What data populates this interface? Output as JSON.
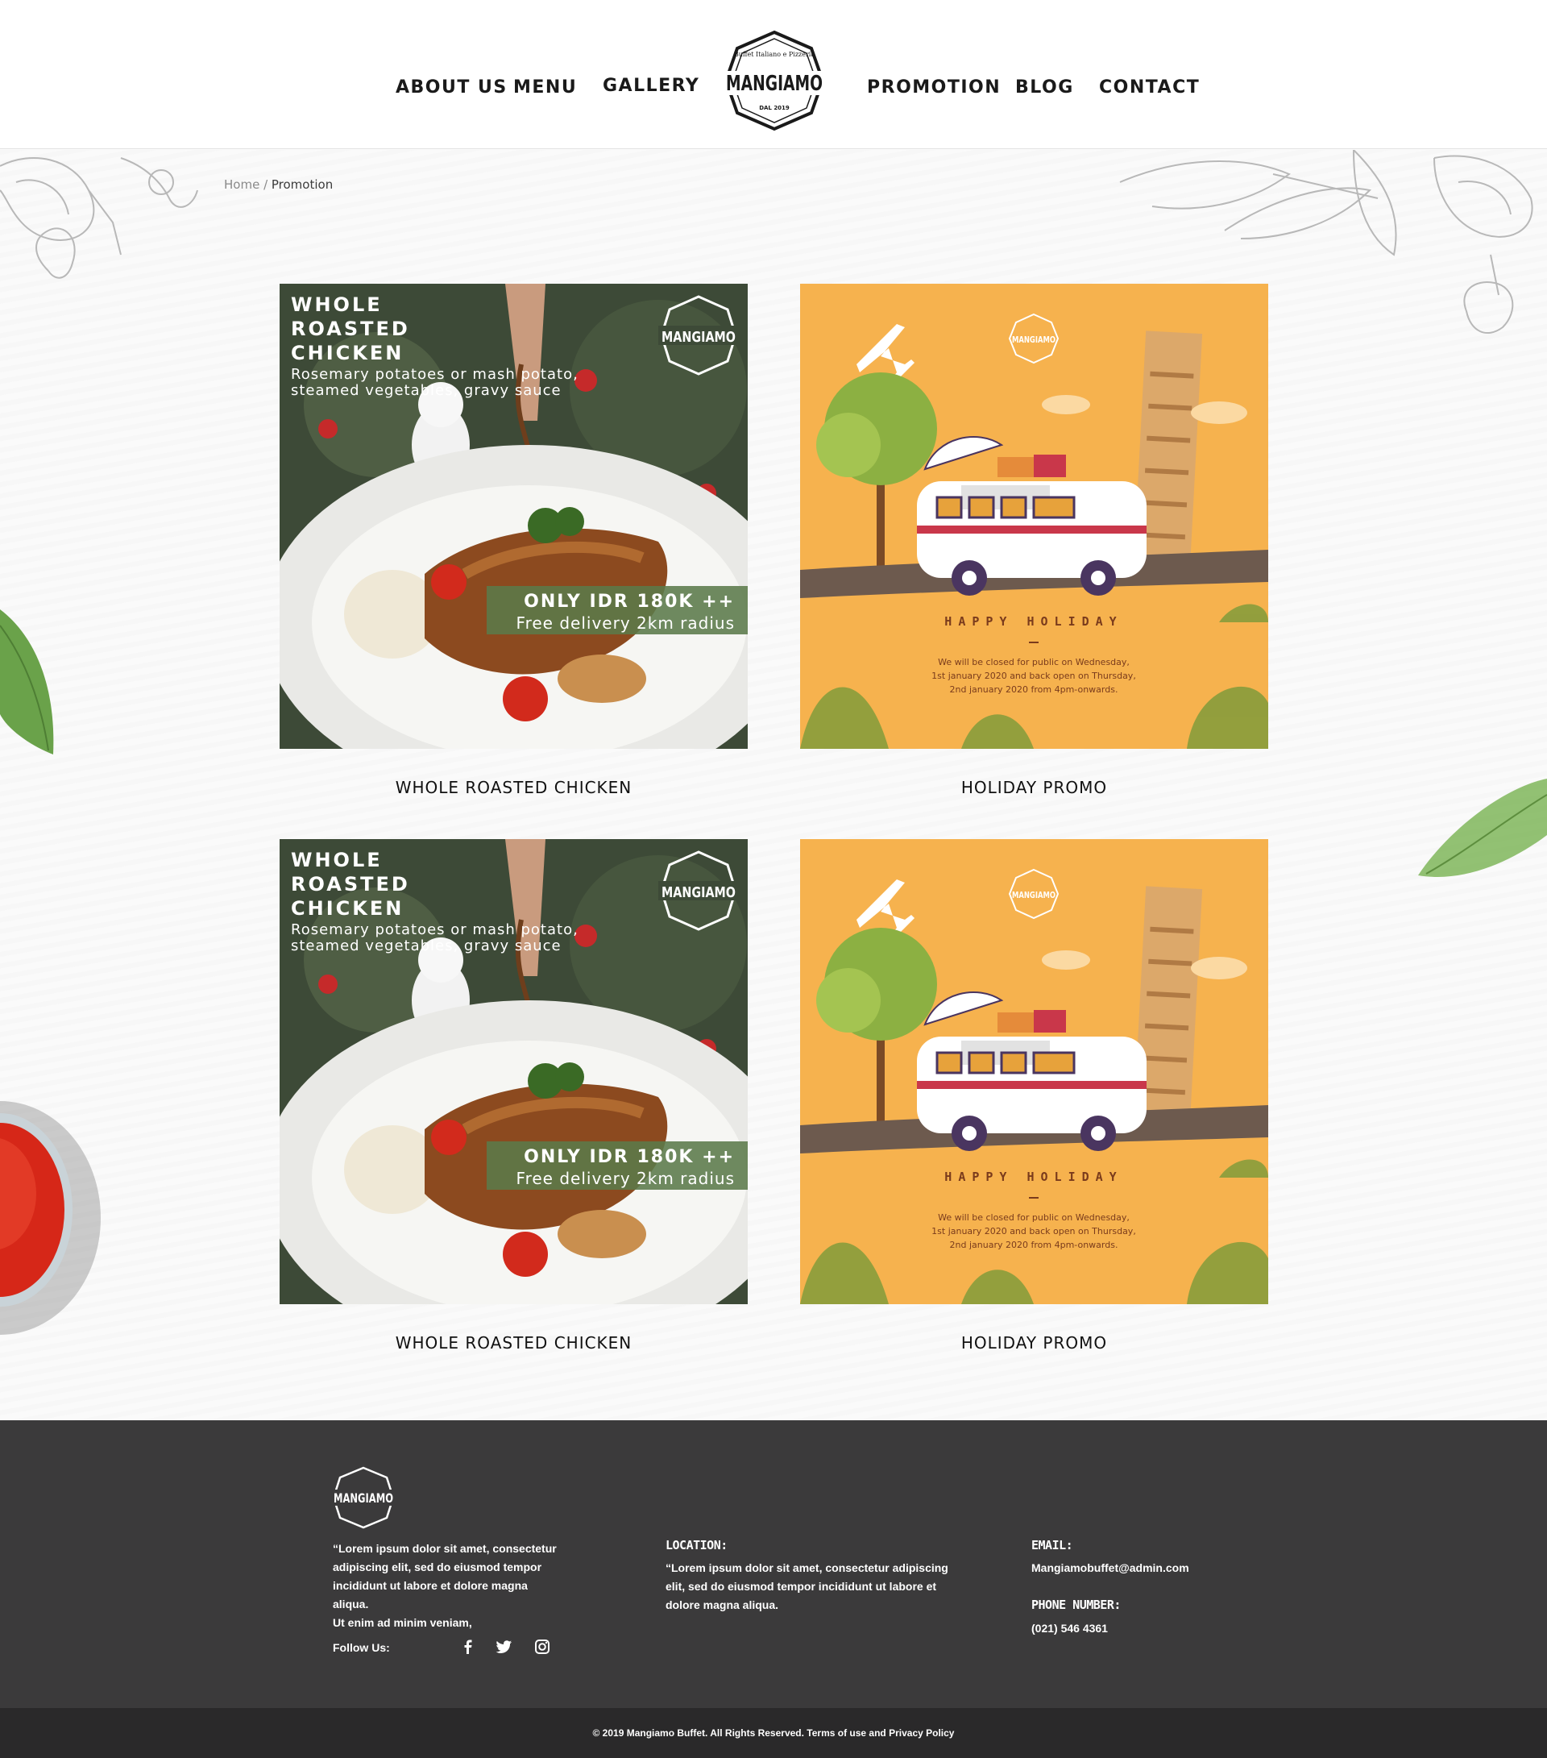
{
  "nav": {
    "about": "ABOUT US",
    "menu": "MENU",
    "gallery": "GALLERY",
    "promotion": "PROMOTION",
    "blog": "BLOG",
    "contact": "CONTACT"
  },
  "logo": {
    "name": "MANGIAMO",
    "tagline": "Buffet Italiano e Pizzeria",
    "year": "DAL 2019"
  },
  "breadcrumb": {
    "home": "Home",
    "separator": " / ",
    "current": "Promotion"
  },
  "promos": [
    {
      "title": "WHOLE ROASTED CHICKEN",
      "image": {
        "line1": "WHOLE",
        "line2": "ROASTED",
        "line3": "CHICKEN",
        "sub1": "Rosemary potatoes or mash potato,",
        "sub2": "steamed vegetables, gravy sauce",
        "price": "ONLY IDR 180K ++",
        "delivery": "Free delivery 2km radius"
      }
    },
    {
      "title": "HOLIDAY PROMO",
      "image": {
        "headline": "HAPPY HOLIDAY",
        "body1": "We will be closed for public on Wednesday,",
        "body2": "1st january 2020 and back open on Thursday,",
        "body3": "2nd january 2020 from 4pm-onwards."
      }
    },
    {
      "title": "WHOLE ROASTED CHICKEN",
      "image": {
        "line1": "WHOLE",
        "line2": "ROASTED",
        "line3": "CHICKEN",
        "sub1": "Rosemary potatoes or mash potato,",
        "sub2": "steamed vegetables, gravy sauce",
        "price": "ONLY IDR 180K ++",
        "delivery": "Free delivery 2km radius"
      }
    },
    {
      "title": "HOLIDAY PROMO",
      "image": {
        "headline": "HAPPY HOLIDAY",
        "body1": "We will be closed for public on Wednesday,",
        "body2": "1st january 2020 and back open on Thursday,",
        "body3": "2nd january 2020 from 4pm-onwards."
      }
    }
  ],
  "footer": {
    "about_line1": "“Lorem ipsum dolor sit amet, consectetur",
    "about_line2": "adipiscing elit, sed do eiusmod tempor",
    "about_line3": "incididunt ut labore et dolore magna aliqua.",
    "about_line4": "Ut enim ad minim veniam,",
    "follow_label": "Follow Us:",
    "social_icons": [
      "facebook-icon",
      "twitter-icon",
      "instagram-icon"
    ],
    "location_heading": "LOCATION:",
    "location_line1": "“Lorem ipsum dolor sit amet, consectetur adipiscing",
    "location_line2": "elit, sed do eiusmod tempor incididunt ut labore et",
    "location_line3": "dolore magna aliqua.",
    "email_heading": "EMAIL:",
    "email": "Mangiamobuffet@admin.com",
    "phone_heading": "PHONE NUMBER:",
    "phone": "(021) 546 4361"
  },
  "copyright": "© 2019 Mangiamo Buffet. All Rights Reserved. Terms of use and Privacy Policy",
  "colors": {
    "header_bg": "#ffffff",
    "footer_bg": "#3b3a3b",
    "bottom_bar_bg": "#2a292a",
    "holiday_orange": "#f6b24e",
    "promo_green": "#5b7a4a"
  }
}
